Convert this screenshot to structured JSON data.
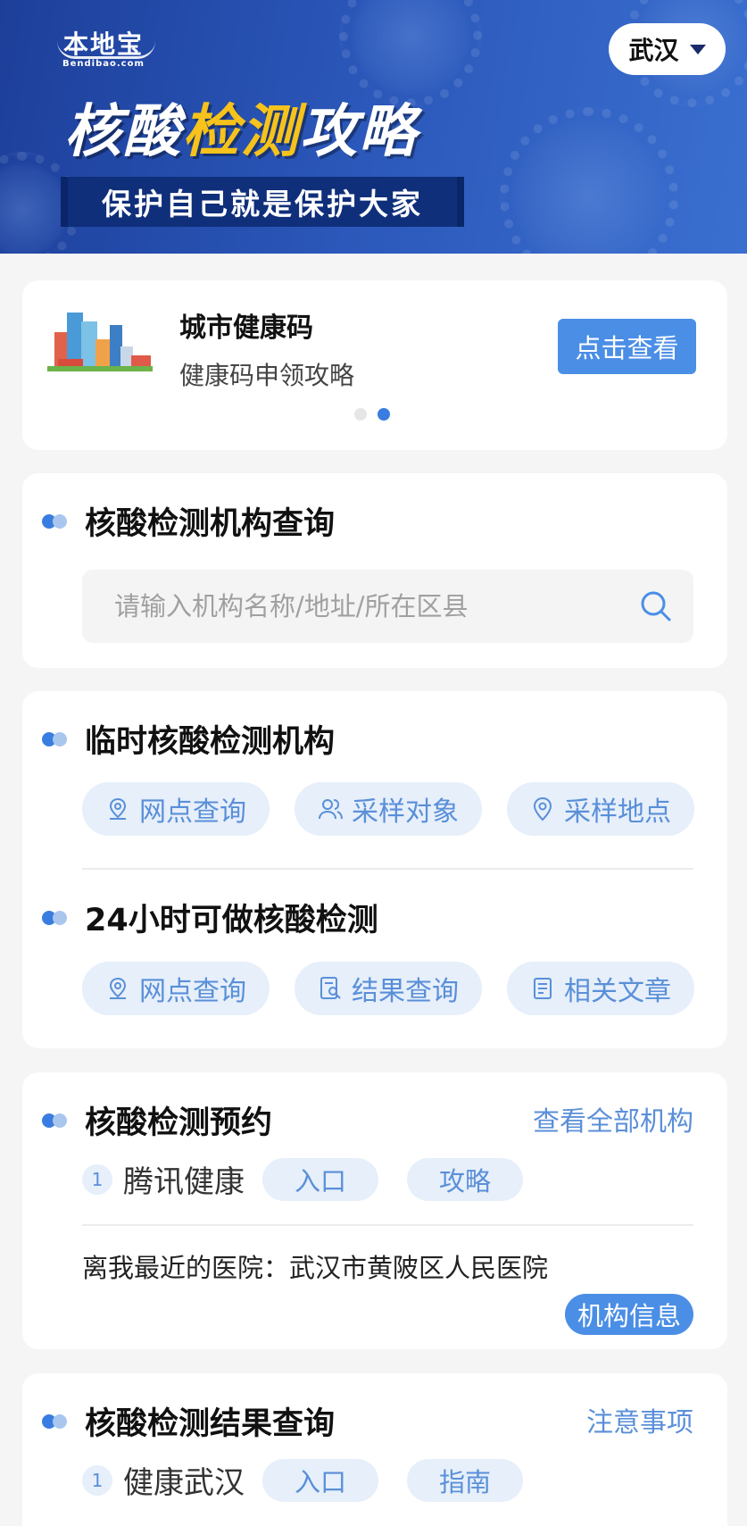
{
  "banner": {
    "logo_main": "本地宝",
    "logo_sub": "Bendibao.com",
    "title_part1": "核酸",
    "title_highlight": "检测",
    "title_part2": "攻略",
    "slogan": "保护自己就是保护大家",
    "city": "武汉"
  },
  "health_code": {
    "title": "城市健康码",
    "subtitle": "健康码申领攻略",
    "button": "点击查看",
    "carousel_dots": 2,
    "active_dot": 2
  },
  "search_section": {
    "title": "核酸检测机构查询",
    "placeholder": "请输入机构名称/地址/所在区县"
  },
  "temp_section": {
    "title": "临时核酸检测机构",
    "pills": [
      {
        "label": "网点查询",
        "icon": "location-pin-icon"
      },
      {
        "label": "采样对象",
        "icon": "people-icon"
      },
      {
        "label": "采样地点",
        "icon": "map-pin-icon"
      }
    ]
  },
  "h24_section": {
    "title": "24小时可做核酸检测",
    "pills": [
      {
        "label": "网点查询",
        "icon": "location-pin-icon"
      },
      {
        "label": "结果查询",
        "icon": "search-document-icon"
      },
      {
        "label": "相关文章",
        "icon": "document-icon"
      }
    ]
  },
  "booking_section": {
    "title": "核酸检测预约",
    "link": "查看全部机构",
    "items": [
      {
        "num": "1",
        "name": "腾讯健康",
        "tags": [
          "入口",
          "攻略"
        ]
      }
    ],
    "nearest": "离我最近的医院：武汉市黄陂区人民医院",
    "org_button": "机构信息"
  },
  "result_section": {
    "title": "核酸检测结果查询",
    "link": "注意事项",
    "items": [
      {
        "num": "1",
        "name": "健康武汉",
        "tags": [
          "入口",
          "指南"
        ]
      }
    ]
  },
  "colors": {
    "accent": "#4b8ee6",
    "pill_bg": "#e6effa",
    "pill_text": "#5a8fd8",
    "title_highlight": "#f6c21b"
  }
}
